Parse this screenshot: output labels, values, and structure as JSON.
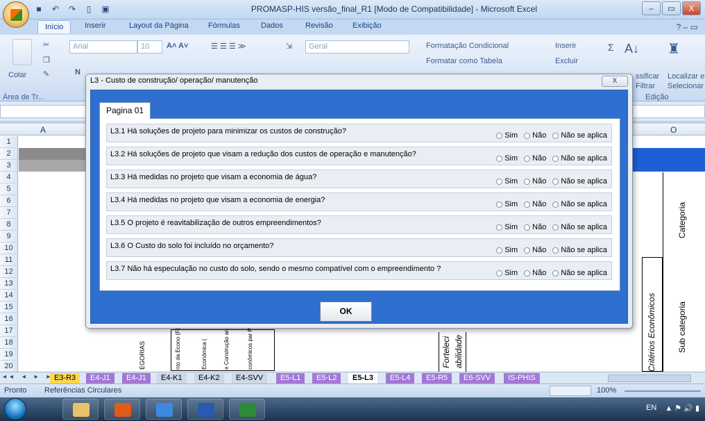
{
  "window": {
    "title": "PROMASP-HIS versão_final_R1  [Modo de Compatibilidade] - Microsoft Excel",
    "controls": [
      "–",
      "▭",
      "X"
    ]
  },
  "ribbon_tabs": [
    "Início",
    "Inserir",
    "Layout da Página",
    "Fórmulas",
    "Dados",
    "Revisão",
    "Exibição"
  ],
  "ribbon": {
    "paste_label": "Colar",
    "clipboard_group": "Área de Tr...",
    "font_name": "Arial",
    "font_size": "10",
    "number_format": "Geral",
    "conditional_formatting": "Formatação Condicional",
    "format_as_table": "Formatar como Tabela",
    "insert": "Inserir",
    "delete": "Excluir",
    "classify_filter_1": "ssificar",
    "classify_filter_2": "Filtrar",
    "find_select_1": "Localizar e",
    "find_select_2": "Selecionar",
    "edit_group": "Edição",
    "bold": "N"
  },
  "grid": {
    "col_a": "A",
    "col_o": "O",
    "rows": [
      "1",
      "2",
      "3",
      "4",
      "5",
      "6",
      "7",
      "8",
      "9",
      "10",
      "11",
      "12",
      "13",
      "14",
      "15",
      "16",
      "17",
      "18",
      "19",
      "20"
    ],
    "vtexts": {
      "categoria": "Categoria",
      "sub_categoria": "Sub categoria",
      "criterios": "Critérios Econômicos",
      "fortaleci": "Forteleci",
      "abilidade": "abilidade",
      "tegorias": "EGORIAS",
      "v1": "nto da Econo (FEL)",
      "v2": "Econômica (",
      "v3": "e Construção anutenção (C",
      "v4": "conômicos par Projeto (C EP)"
    }
  },
  "sheet_tabs": {
    "items": [
      "E3-R3",
      "E4-J1",
      "E4-J1",
      "E4-K1",
      "E4-K2",
      "E4-SVV",
      "E5-L1",
      "E5-L2",
      "E5-L3",
      "E5-L4",
      "E5-R5",
      "E6-SVV",
      "IS-PHIS"
    ],
    "active": "E5-L3"
  },
  "status": {
    "ready": "Pronto",
    "circular": "Referências Circulares",
    "zoom": "100%"
  },
  "taskbar": {
    "lang": "EN"
  },
  "dialog": {
    "title": "L3 - Custo de construção/ operação/ manutenção",
    "close_label": "X",
    "page_tab": "Pagina 01",
    "ok_label": "OK",
    "options": [
      "Sim",
      "Não",
      "Não se aplica"
    ],
    "questions": [
      "L3.1 Há soluções de projeto para minimizar os custos de construção?",
      "L3.2 Há soluções de projeto que visam a redução dos custos de operação e manutenção?",
      "L3.3 Há medidas no projeto que visam a economia de água?",
      "L3.4 Há medidas no projeto que visam a economia de energia?",
      "L3.5 O projeto é reavitabilização de outros empreendimentos?",
      "L3.6 O Custo do solo foi incluído no orçamento?",
      "L3.7 Não há especulação no custo do solo, sendo o mesmo compatível com o empreendimento ?"
    ]
  },
  "colors": {
    "dialog_blue": "#2f6fcf",
    "grid_blue": "#1f5fd6",
    "grid_gray": "#8c8c8c"
  }
}
